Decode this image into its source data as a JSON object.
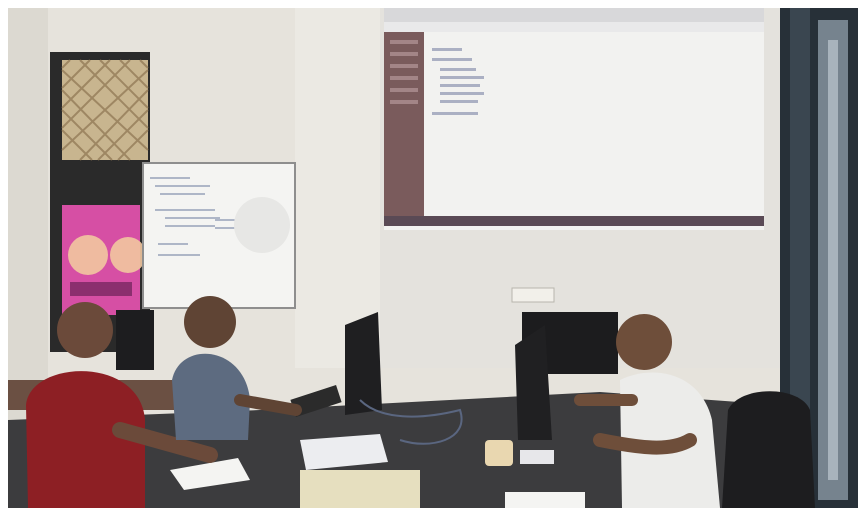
{
  "scene": {
    "description_tags": [
      "office",
      "projector-screen",
      "whiteboard",
      "computer-monitors",
      "three-people"
    ],
    "colors": {
      "wall": "#e7e4dd",
      "projection": "#f3f3f1",
      "desk": "#3a3a3a"
    }
  }
}
